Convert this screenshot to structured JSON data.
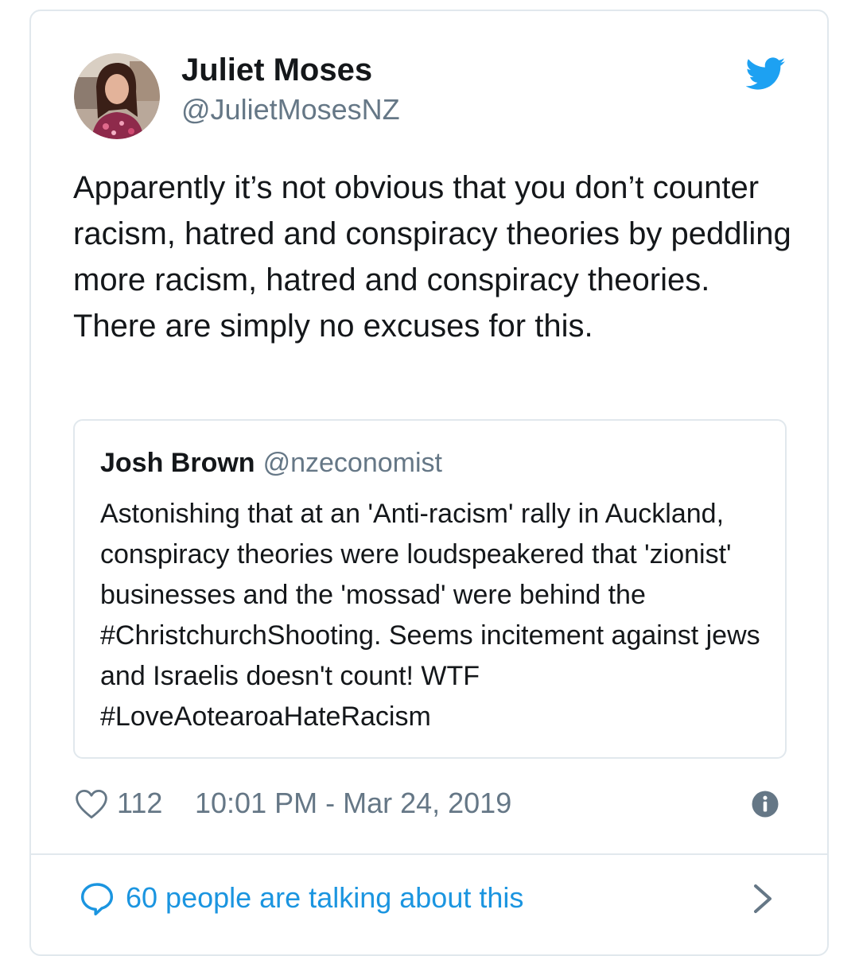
{
  "tweet": {
    "author_name": "Juliet Moses",
    "author_handle": "@JulietMosesNZ",
    "text": "Apparently it’s not obvious that you don’t counter racism, hatred and conspiracy theories by peddling more racism, hatred and conspiracy theories.\nThere are simply no excuses for this.",
    "likes": "112",
    "timestamp": "10:01 PM - Mar 24, 2019",
    "talking": "60 people are talking about this"
  },
  "quoted": {
    "author_name": "Josh Brown",
    "author_handle": "@nzeconomist",
    "text": "Astonishing that at an 'Anti-racism' rally in Auckland, conspiracy theories were loudspeakered that 'zionist' businesses and the 'mossad' were behind the #ChristchurchShooting.  Seems incitement against jews and Israelis doesn't count! WTF #LoveAotearoaHateRacism"
  },
  "icons": {
    "brand": "twitter-bird-icon",
    "like": "heart-icon",
    "info": "info-icon",
    "reply": "speech-bubble-icon",
    "more": "chevron-right-icon"
  },
  "colors": {
    "twitter_blue": "#1da1f2",
    "link_blue": "#1b95e0",
    "muted": "#657786",
    "border": "#e1e8ed",
    "text": "#14171a"
  }
}
